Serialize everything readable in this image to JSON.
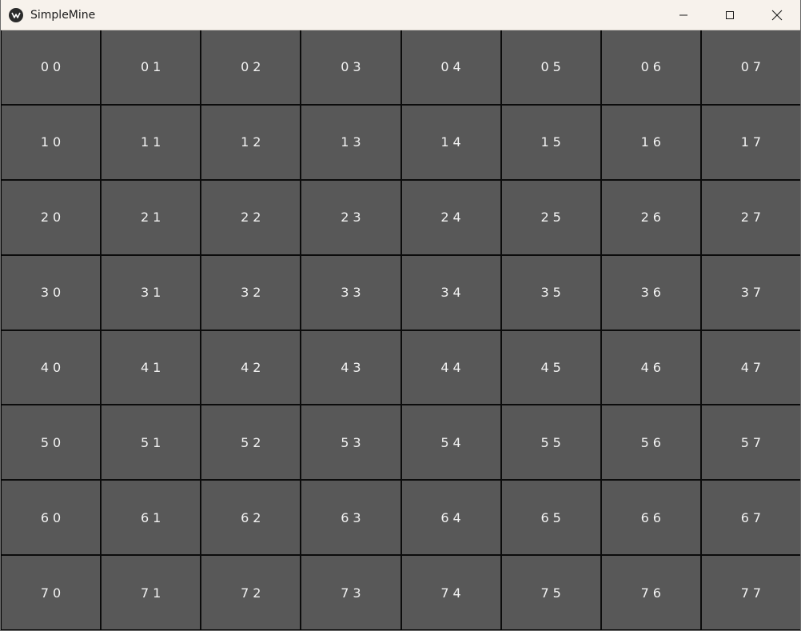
{
  "window": {
    "title": "SimpleMine",
    "controls": {
      "minimize_icon": "minimize-icon",
      "maximize_icon": "maximize-icon",
      "close_icon": "close-icon"
    }
  },
  "board": {
    "cell_color": "#585858",
    "text_color": "#f2f2f2",
    "rows": [
      [
        "00",
        "01",
        "02",
        "03",
        "04",
        "05",
        "06",
        "07"
      ],
      [
        "10",
        "11",
        "12",
        "13",
        "14",
        "15",
        "16",
        "17"
      ],
      [
        "20",
        "21",
        "22",
        "23",
        "24",
        "25",
        "26",
        "27"
      ],
      [
        "30",
        "31",
        "32",
        "33",
        "34",
        "35",
        "36",
        "37"
      ],
      [
        "40",
        "41",
        "42",
        "43",
        "44",
        "45",
        "46",
        "47"
      ],
      [
        "50",
        "51",
        "52",
        "53",
        "54",
        "55",
        "56",
        "57"
      ],
      [
        "60",
        "61",
        "62",
        "63",
        "64",
        "65",
        "66",
        "67"
      ],
      [
        "70",
        "71",
        "72",
        "73",
        "74",
        "75",
        "76",
        "77"
      ]
    ]
  }
}
